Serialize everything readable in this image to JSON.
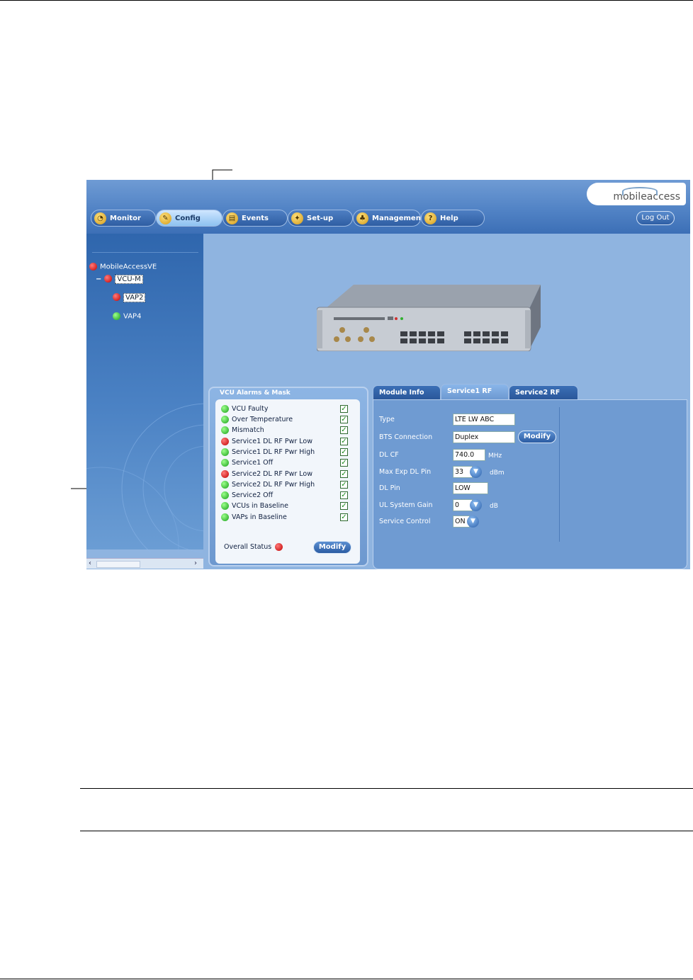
{
  "app": {
    "logo_text": "mobileaccess",
    "nav": [
      {
        "label": "Monitor"
      },
      {
        "label": "Config"
      },
      {
        "label": "Events"
      },
      {
        "label": "Set-up"
      },
      {
        "label": "Management"
      },
      {
        "label": "Help"
      }
    ],
    "logout_label": "Log Out"
  },
  "tree": {
    "root": "MobileAccessVE",
    "collapse_glyph": "−",
    "vcu": "VCU-M",
    "children": [
      "VAP2",
      "VAP4"
    ]
  },
  "alarms": {
    "title": "VCU Alarms & Mask",
    "items": [
      {
        "label": "VCU Faulty",
        "status": "green"
      },
      {
        "label": "Over Temperature",
        "status": "green"
      },
      {
        "label": "Mismatch",
        "status": "green"
      },
      {
        "label": "Service1 DL RF Pwr Low",
        "status": "red"
      },
      {
        "label": "Service1 DL RF Pwr High",
        "status": "green"
      },
      {
        "label": "Service1 Off",
        "status": "green"
      },
      {
        "label": "Service2 DL RF Pwr Low",
        "status": "red"
      },
      {
        "label": "Service2 DL RF Pwr High",
        "status": "green"
      },
      {
        "label": "Service2 Off",
        "status": "green"
      },
      {
        "label": "VCUs in Baseline",
        "status": "green"
      },
      {
        "label": "VAPs in Baseline",
        "status": "green"
      }
    ],
    "overall_label": "Overall Status",
    "modify_label": "Modify"
  },
  "service": {
    "tabs": [
      "Module Info",
      "Service1 RF",
      "Service2 RF"
    ],
    "fields": {
      "type_label": "Type",
      "type_value": "LTE LW ABC",
      "bts_label": "BTS Connection",
      "bts_value": "Duplex",
      "bts_modify": "Modify",
      "dlcf_label": "DL CF",
      "dlcf_value": "740.0",
      "dlcf_unit": "MHz",
      "maxexp_label": "Max Exp DL Pin",
      "maxexp_value": "33",
      "maxexp_unit": "dBm",
      "dlpin_label": "DL Pin",
      "dlpin_value": "LOW",
      "ulgain_label": "UL System Gain",
      "ulgain_value": "0",
      "ulgain_unit": "dB",
      "svcctrl_label": "Service Control",
      "svcctrl_value": "ON"
    }
  },
  "colors": {
    "status_red": "#c00000",
    "status_green": "#18a018",
    "app_blue": "#4f81c4"
  }
}
